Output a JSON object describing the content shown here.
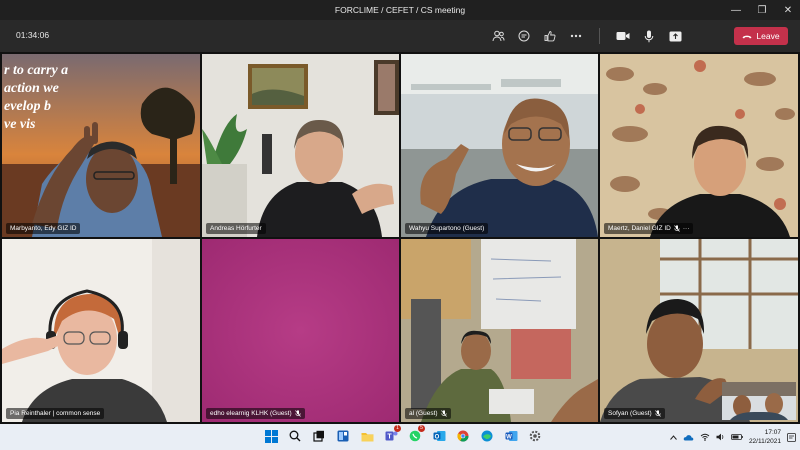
{
  "window": {
    "title": "FORCLIME / CEFET / CS meeting",
    "controls": [
      "—",
      "❐",
      "✕"
    ]
  },
  "toolbar": {
    "timer": "01:34:06",
    "icons": [
      "people-icon",
      "chat-icon",
      "reactions-icon",
      "more-icon",
      "camera-icon",
      "mic-icon",
      "share-icon"
    ],
    "leave_label": "Leave"
  },
  "participants": [
    {
      "name": "Marbyanto, Edy GIZ ID",
      "muted": false
    },
    {
      "name": "Andreas Hörfurter",
      "muted": false
    },
    {
      "name": "Wahyu Supartono (Guest)",
      "muted": false
    },
    {
      "name": "Maertz, Daniel GIZ ID",
      "muted": true,
      "more": "···"
    },
    {
      "name": "Pia Reinthaler | common sense",
      "muted": false
    },
    {
      "name": "edho elearnig KLHK (Guest)",
      "muted": true
    },
    {
      "name": "al (Guest)",
      "muted": true
    },
    {
      "name": "Sofyan (Guest)",
      "muted": true
    }
  ],
  "background_text": [
    "r to carry a",
    "action we",
    "evelop b",
    "ve vis"
  ],
  "taskbar": {
    "apps": [
      "windows-start-icon",
      "search-icon",
      "task-view-icon",
      "widgets-icon",
      "file-explorer-icon",
      "teams-icon",
      "whatsapp-icon",
      "outlook-icon",
      "chrome-icon",
      "edge-icon",
      "word-icon",
      "settings-icon"
    ],
    "badges": {
      "teams": "1",
      "whatsapp": "5"
    },
    "time": "17:07",
    "date": "22/11/2021"
  }
}
